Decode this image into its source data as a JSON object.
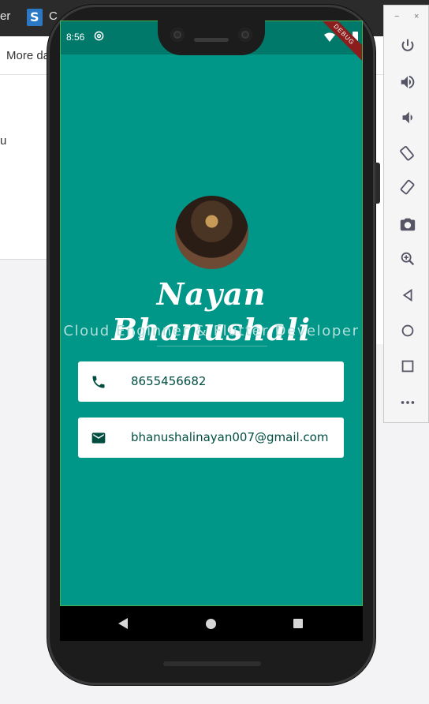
{
  "background": {
    "topbar_word": "er",
    "topbar_letter": "C",
    "menu_text": "More da",
    "side_text": "u"
  },
  "device": {
    "status": {
      "time": "8:56",
      "debug_label": "DEBUG"
    },
    "app": {
      "name": "Nayan Bhanushali",
      "title": "Cloud Enginner & Flutter Developer",
      "phone": "8655456682",
      "email": "bhanushalinayan007@gmail.com"
    },
    "nav": {
      "icons": [
        "back-icon",
        "home-icon",
        "recents-icon"
      ]
    }
  },
  "toolbar": {
    "minimize": "−",
    "close": "×",
    "buttons": [
      "power-icon",
      "volume-up-icon",
      "volume-down-icon",
      "rotate-left-icon",
      "rotate-right-icon",
      "screenshot-icon",
      "zoom-icon",
      "back-icon",
      "home-icon",
      "overview-icon",
      "more-icon"
    ]
  },
  "colors": {
    "app_background": "#009688",
    "status_bar": "#00796b",
    "card_text": "#004d40",
    "subtitle": "#b2dfdb"
  }
}
